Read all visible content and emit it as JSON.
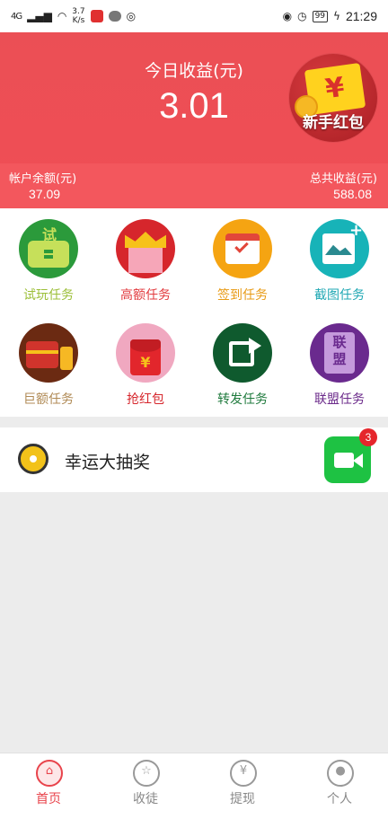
{
  "status_bar": {
    "signal": "4G",
    "net_speed": "3.7\nK/s",
    "battery": "99",
    "time": "21:29"
  },
  "header": {
    "today_label": "今日收益(元)",
    "today_value": "3.01",
    "newbie_badge_label": "新手红包",
    "newbie_badge_symbol": "¥",
    "balance_label": "帐户余额(元)",
    "balance_value": "37.09",
    "total_label": "总共收益(元)",
    "total_value": "588.08"
  },
  "tasks": [
    {
      "label": "试玩任务",
      "color": "#9cbf39",
      "icon": "trial-task-icon",
      "icon_bg": "#2b9a3b"
    },
    {
      "label": "高额任务",
      "color": "#e23b3f",
      "icon": "crown-task-icon",
      "icon_bg": "#d6262c"
    },
    {
      "label": "签到任务",
      "color": "#e89b16",
      "icon": "calendar-task-icon",
      "icon_bg": "#f5a412"
    },
    {
      "label": "截图任务",
      "color": "#20a8b4",
      "icon": "screenshot-task-icon",
      "icon_bg": "#17b3b8"
    },
    {
      "label": "巨额任务",
      "color": "#b08a55",
      "icon": "treasure-task-icon",
      "icon_bg": "#6b2a12"
    },
    {
      "label": "抢红包",
      "color": "#d6262c",
      "icon": "red-envelope-task-icon",
      "icon_bg": "#f0a8c0"
    },
    {
      "label": "转发任务",
      "color": "#1f7a3d",
      "icon": "share-task-icon",
      "icon_bg": "#0f5a2e"
    },
    {
      "label": "联盟任务",
      "color": "#6b2a8a",
      "icon": "alliance-task-icon",
      "icon_bg": "#6a2a8e"
    }
  ],
  "task_icon_text": {
    "trial": "试",
    "envelope": "¥",
    "alliance": "联\n盟"
  },
  "lucky_draw": {
    "label": "幸运大抽奖",
    "video_badge_count": "3"
  },
  "bottom_nav": [
    {
      "label": "首页",
      "icon": "home-icon",
      "active": true
    },
    {
      "label": "收徒",
      "icon": "apprentice-icon",
      "active": false
    },
    {
      "label": "提现",
      "icon": "withdraw-icon",
      "active": false
    },
    {
      "label": "个人",
      "icon": "profile-icon",
      "active": false
    }
  ],
  "colors": {
    "accent": "#eb4f55",
    "active_nav": "#e8434b",
    "video_button": "#1ec243"
  }
}
